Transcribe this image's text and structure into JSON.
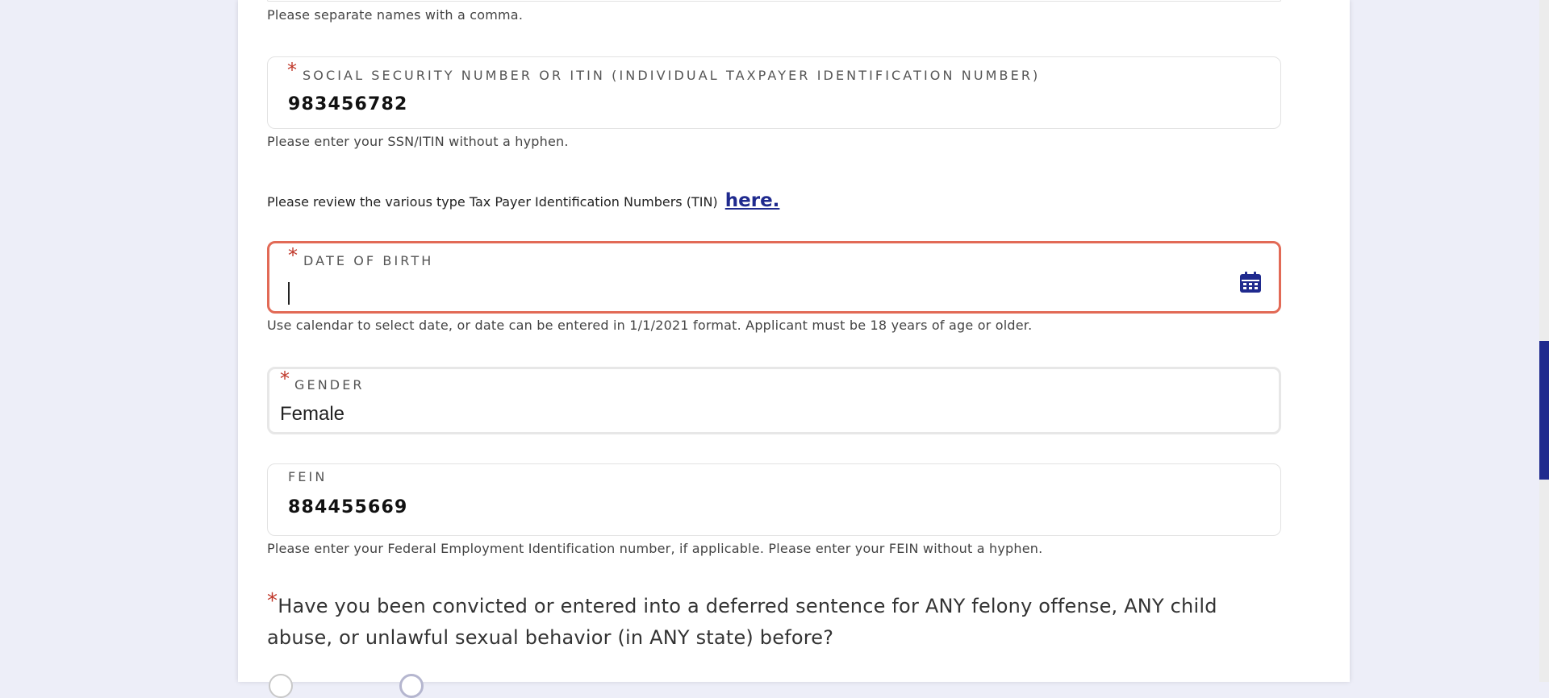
{
  "names_help": "Please separate names with a comma.",
  "ssn": {
    "label": "SOCIAL SECURITY NUMBER OR ITIN (INDIVIDUAL TAXPAYER IDENTIFICATION NUMBER)",
    "value": "983456782",
    "help": "Please enter your SSN/ITIN without a hyphen."
  },
  "tin_review": {
    "text": "Please review the various type Tax Payer Identification Numbers (TIN)",
    "link": "here."
  },
  "dob": {
    "label": "DATE OF BIRTH",
    "value": "",
    "help": "Use calendar to select date, or date can be entered in 1/1/2021 format. Applicant must be 18 years of age or older.",
    "icon": "calendar-icon"
  },
  "gender": {
    "label": "GENDER",
    "value": "Female"
  },
  "fein": {
    "label": "FEIN",
    "value": "884455669",
    "help": "Please enter your Federal Employment Identification number, if applicable. Please enter your FEIN without a hyphen."
  },
  "question": {
    "text": "Have you been convicted or entered into a deferred sentence for ANY felony offense, ANY child abuse, or unlawful sexual behavior (in ANY state) before?"
  },
  "required_marker": "*",
  "colors": {
    "accent": "#1f2a8e",
    "error_border": "#e26a56",
    "required": "#c0392b",
    "background": "#edeef8"
  }
}
